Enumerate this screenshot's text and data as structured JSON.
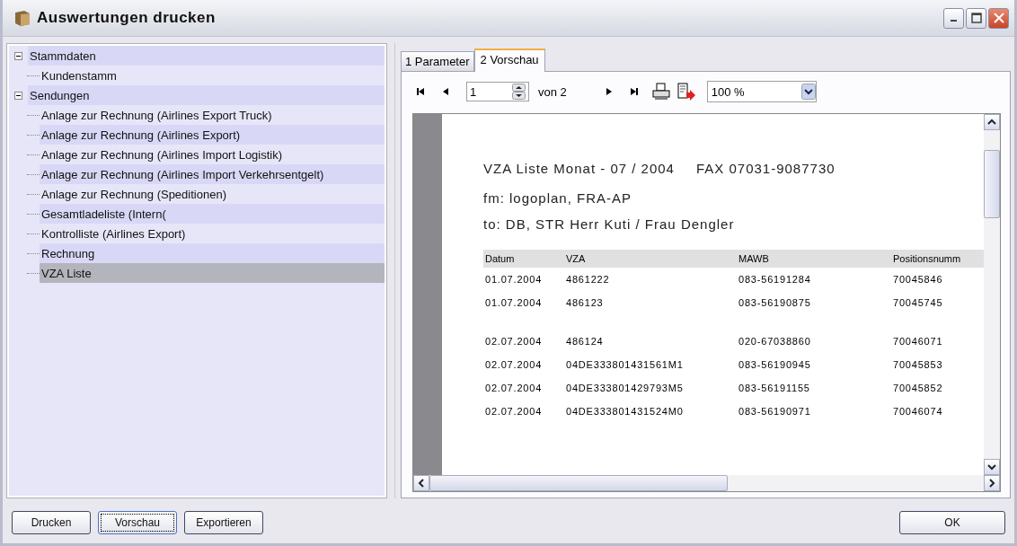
{
  "window": {
    "title": "Auswertungen drucken"
  },
  "tree": [
    {
      "label": "Stammdaten",
      "expanded": true,
      "selected": false,
      "children": [
        {
          "label": "Kundenstamm",
          "selected": false
        }
      ]
    },
    {
      "label": "Sendungen",
      "expanded": true,
      "selected": false,
      "children": [
        {
          "label": "Anlage zur Rechnung (Airlines Export Truck)",
          "selected": false
        },
        {
          "label": "Anlage zur Rechnung (Airlines Export)",
          "selected": false
        },
        {
          "label": "Anlage zur Rechnung (Airlines Import Logistik)",
          "selected": false
        },
        {
          "label": "Anlage zur Rechnung (Airlines Import Verkehrsentgelt)",
          "selected": false
        },
        {
          "label": "Anlage zur Rechnung (Speditionen)",
          "selected": false
        },
        {
          "label": "Gesamtladeliste (Intern(",
          "selected": false
        },
        {
          "label": "Kontrolliste (Airlines Export)",
          "selected": false
        },
        {
          "label": "Rechnung",
          "selected": false
        },
        {
          "label": "VZA Liste",
          "selected": true
        }
      ]
    }
  ],
  "tabs": [
    {
      "label": "1 Parameter",
      "selected": false
    },
    {
      "label": "2 Vorschau",
      "selected": true
    }
  ],
  "toolbar": {
    "page": "1",
    "page_of": "von 2",
    "zoom": "100 %"
  },
  "report": {
    "title": "VZA Liste Monat - 07 / 2004",
    "fax": "FAX 07031-9087730",
    "from": "fm: logoplan, FRA-AP",
    "to": "to: DB, STR Herr Kuti / Frau Dengler",
    "columns": [
      "Datum",
      "VZA",
      "MAWB",
      "Positionsnumm"
    ],
    "groups": [
      [
        [
          "01.07.2004",
          "4861222",
          "083-56191284",
          "70045846"
        ],
        [
          "01.07.2004",
          "486123",
          "083-56190875",
          "70045745"
        ]
      ],
      [
        [
          "02.07.2004",
          "486124",
          "020-67038860",
          "70046071"
        ],
        [
          "02.07.2004",
          "04DE333801431561M1",
          "083-56190945",
          "70045853"
        ],
        [
          "02.07.2004",
          "04DE333801429793M5",
          "083-56191155",
          "70045852"
        ],
        [
          "02.07.2004",
          "04DE333801431524M0",
          "083-56190971",
          "70046074"
        ]
      ]
    ]
  },
  "buttons": [
    {
      "label": "Drucken",
      "focused": false
    },
    {
      "label": "Vorschau",
      "focused": true
    },
    {
      "label": "Exportieren",
      "focused": false
    }
  ],
  "ok_button": "OK"
}
